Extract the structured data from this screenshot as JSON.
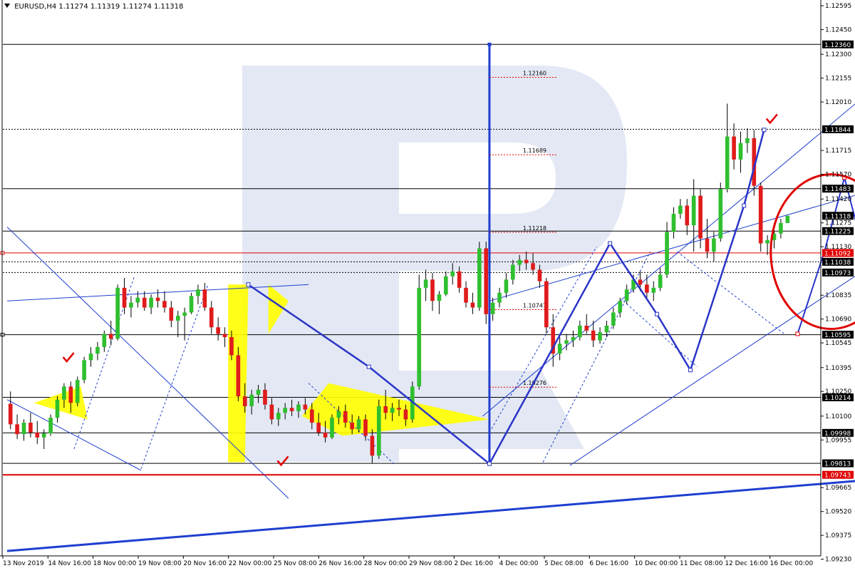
{
  "header": {
    "symbol": "EURUSD,H4",
    "ohlc": "1.11274 1.11319 1.11274 1.11318"
  },
  "colors": {
    "bull": "#2fbf2f",
    "bear": "#e01b1b",
    "trend": "#1f3fd0",
    "wave": "#2a35c8",
    "hline": "#000000",
    "support": "#e00000",
    "circle": "#e00000",
    "highlight": "#ffff00",
    "watermark": "#e3e8f4",
    "fib": "#e00000"
  },
  "chart_data": {
    "type": "candlestick",
    "price_axis": {
      "min": 1.0925,
      "max": 1.1263,
      "ticks": [
        "1.12595",
        "1.12450",
        "1.12300",
        "1.12155",
        "1.12010",
        "1.11715",
        "1.11570",
        "1.11420",
        "1.11275",
        "1.11130",
        "1.10835",
        "1.10690",
        "1.10545",
        "1.10395",
        "1.10250",
        "1.10100",
        "1.09955",
        "1.09665",
        "1.09520",
        "1.09375",
        "1.09230"
      ]
    },
    "time_axis": {
      "labels": [
        "13 Nov 2019",
        "14 Nov 16:00",
        "18 Nov 00:00",
        "19 Nov 08:00",
        "20 Nov 16:00",
        "22 Nov 00:00",
        "25 Nov 08:00",
        "26 Nov 16:00",
        "28 Nov 00:00",
        "29 Nov 08:00",
        "2 Dec 16:00",
        "4 Dec 00:00",
        "5 Dec 08:00",
        "6 Dec 16:00",
        "10 Dec 00:00",
        "11 Dec 08:00",
        "12 Dec 16:00",
        "16 Dec 00:00"
      ]
    },
    "levels": [
      {
        "value": 1.1236,
        "label": "1.12360",
        "style": "solid"
      },
      {
        "value": 1.11844,
        "label": "1.11844",
        "style": "dotted"
      },
      {
        "value": 1.11483,
        "label": "1.11483",
        "style": "solid"
      },
      {
        "value": 1.11318,
        "label": "1.11318",
        "style": "current"
      },
      {
        "value": 1.11225,
        "label": "1.11225",
        "style": "solid"
      },
      {
        "value": 1.11092,
        "label": "1.11092",
        "style": "red"
      },
      {
        "value": 1.11038,
        "label": "1.11038",
        "style": "dotted"
      },
      {
        "value": 1.10973,
        "label": "1.10973",
        "style": "dotted"
      },
      {
        "value": 1.10595,
        "label": "1.10595",
        "style": "solid"
      },
      {
        "value": 1.10214,
        "label": "1.10214",
        "style": "solid"
      },
      {
        "value": 1.09998,
        "label": "1.09998",
        "style": "solid"
      },
      {
        "value": 1.09813,
        "label": "1.09813",
        "style": "solid"
      },
      {
        "value": 1.09743,
        "label": "1.09743",
        "style": "support"
      }
    ],
    "fib_labels": [
      {
        "value": 1.1216,
        "label": "1.12160"
      },
      {
        "value": 1.11689,
        "label": "1.11689"
      },
      {
        "value": 1.11218,
        "label": "1.11218"
      },
      {
        "value": 1.10747,
        "label": "1.10747"
      },
      {
        "value": 1.10276,
        "label": "1.10276"
      }
    ],
    "candles": [
      [
        1.10175,
        1.1025,
        1.1002,
        1.1005
      ],
      [
        1.1005,
        1.1011,
        1.0996,
        1.0999
      ],
      [
        1.0999,
        1.1008,
        1.0995,
        1.1006
      ],
      [
        1.1006,
        1.1012,
        1.0997,
        1.1
      ],
      [
        1.1,
        1.1007,
        1.0993,
        1.0997
      ],
      [
        1.0997,
        1.1002,
        1.099,
        1.09995
      ],
      [
        1.09995,
        1.1011,
        1.0998,
        1.1009
      ],
      [
        1.1009,
        1.1022,
        1.1006,
        1.102
      ],
      [
        1.102,
        1.103,
        1.1015,
        1.1028
      ],
      [
        1.1028,
        1.1031,
        1.1012,
        1.1018
      ],
      [
        1.1018,
        1.1034,
        1.1016,
        1.1032
      ],
      [
        1.1032,
        1.1046,
        1.103,
        1.1044
      ],
      [
        1.1044,
        1.1052,
        1.104,
        1.1048
      ],
      [
        1.1048,
        1.1055,
        1.1044,
        1.1052
      ],
      [
        1.1052,
        1.1062,
        1.1049,
        1.106
      ],
      [
        1.106,
        1.1068,
        1.1053,
        1.1057
      ],
      [
        1.1057,
        1.109,
        1.1056,
        1.1088
      ],
      [
        1.1088,
        1.1094,
        1.1072,
        1.1076
      ],
      [
        1.1076,
        1.1083,
        1.107,
        1.1079
      ],
      [
        1.1079,
        1.1086,
        1.1076,
        1.1082
      ],
      [
        1.1082,
        1.1086,
        1.1074,
        1.1076
      ],
      [
        1.1076,
        1.1084,
        1.1072,
        1.1082
      ],
      [
        1.1082,
        1.1087,
        1.1076,
        1.108
      ],
      [
        1.108,
        1.1086,
        1.1073,
        1.1076
      ],
      [
        1.1076,
        1.108,
        1.1064,
        1.1068
      ],
      [
        1.1068,
        1.1074,
        1.1058,
        1.1071
      ],
      [
        1.1071,
        1.1076,
        1.1056,
        1.1073
      ],
      [
        1.1073,
        1.1085,
        1.1072,
        1.1083
      ],
      [
        1.1083,
        1.109,
        1.1078,
        1.1087
      ],
      [
        1.1087,
        1.1091,
        1.1074,
        1.1076
      ],
      [
        1.1076,
        1.108,
        1.106,
        1.1064
      ],
      [
        1.1064,
        1.107,
        1.1056,
        1.106
      ],
      [
        1.106,
        1.1064,
        1.1052,
        1.1058
      ],
      [
        1.1058,
        1.1062,
        1.1044,
        1.1047
      ],
      [
        1.1047,
        1.1052,
        1.1019,
        1.1022
      ],
      [
        1.1022,
        1.103,
        1.1012,
        1.1016
      ],
      [
        1.1016,
        1.1026,
        1.1011,
        1.1023
      ],
      [
        1.1023,
        1.1029,
        1.1018,
        1.1026
      ],
      [
        1.1026,
        1.103,
        1.1014,
        1.1017
      ],
      [
        1.1017,
        1.1021,
        1.1005,
        1.1008
      ],
      [
        1.1008,
        1.1015,
        1.1004,
        1.1012
      ],
      [
        1.1012,
        1.1018,
        1.1008,
        1.1015
      ],
      [
        1.1015,
        1.102,
        1.101,
        1.1013
      ],
      [
        1.1013,
        1.1019,
        1.1009,
        1.1017
      ],
      [
        1.1017,
        1.1021,
        1.1011,
        1.1014
      ],
      [
        1.1014,
        1.1018,
        1.1002,
        1.1006
      ],
      [
        1.1006,
        1.1012,
        1.0998,
        1.1
      ],
      [
        1.1,
        1.1007,
        1.0994,
        1.0997
      ],
      [
        1.0997,
        1.1011,
        1.0996,
        1.1009
      ],
      [
        1.1009,
        1.1016,
        1.1005,
        1.1013
      ],
      [
        1.1013,
        1.1017,
        1.1003,
        1.1006
      ],
      [
        1.1006,
        1.1011,
        1.0999,
        1.1002
      ],
      [
        1.1002,
        1.101,
        1.1,
        1.1008
      ],
      [
        1.1008,
        1.1011,
        1.0995,
        1.0998
      ],
      [
        1.0998,
        1.1002,
        1.09813,
        1.0986
      ],
      [
        1.0986,
        1.102,
        1.0984,
        1.1016
      ],
      [
        1.1016,
        1.1026,
        1.1008,
        1.1012
      ],
      [
        1.1012,
        1.1018,
        1.1007,
        1.1015
      ],
      [
        1.1015,
        1.102,
        1.101,
        1.1014
      ],
      [
        1.1014,
        1.1017,
        1.1004,
        1.1008
      ],
      [
        1.1008,
        1.1031,
        1.1006,
        1.1028
      ],
      [
        1.1028,
        1.1096,
        1.1026,
        1.1088
      ],
      [
        1.1088,
        1.1099,
        1.108,
        1.1093
      ],
      [
        1.1093,
        1.1097,
        1.1074,
        1.108
      ],
      [
        1.108,
        1.1086,
        1.1072,
        1.1084
      ],
      [
        1.1084,
        1.1098,
        1.1083,
        1.1095
      ],
      [
        1.1095,
        1.1103,
        1.109,
        1.1098
      ],
      [
        1.1098,
        1.1101,
        1.1085,
        1.1088
      ],
      [
        1.1088,
        1.1092,
        1.1076,
        1.1079
      ],
      [
        1.1079,
        1.1085,
        1.1072,
        1.1076
      ],
      [
        1.1076,
        1.1116,
        1.1074,
        1.1112
      ],
      [
        1.1112,
        1.1116,
        1.1066,
        1.1072
      ],
      [
        1.1072,
        1.1082,
        1.1068,
        1.1079
      ],
      [
        1.1079,
        1.1088,
        1.1076,
        1.1085
      ],
      [
        1.1085,
        1.1097,
        1.1082,
        1.1093
      ],
      [
        1.1093,
        1.1105,
        1.109,
        1.1102
      ],
      [
        1.1102,
        1.1108,
        1.1098,
        1.1105
      ],
      [
        1.1105,
        1.111,
        1.1099,
        1.1103
      ],
      [
        1.1103,
        1.1109,
        1.1096,
        1.1099
      ],
      [
        1.1099,
        1.1102,
        1.1088,
        1.1092
      ],
      [
        1.1092,
        1.1094,
        1.106,
        1.1064
      ],
      [
        1.1064,
        1.1072,
        1.104,
        1.1048
      ],
      [
        1.1048,
        1.1058,
        1.1044,
        1.1054
      ],
      [
        1.1054,
        1.106,
        1.105,
        1.1056
      ],
      [
        1.1056,
        1.1062,
        1.1052,
        1.1058
      ],
      [
        1.1058,
        1.1068,
        1.1056,
        1.1065
      ],
      [
        1.1065,
        1.1072,
        1.106,
        1.1062
      ],
      [
        1.1062,
        1.1068,
        1.1052,
        1.1056
      ],
      [
        1.1056,
        1.1064,
        1.1054,
        1.1061
      ],
      [
        1.1061,
        1.1068,
        1.1058,
        1.1065
      ],
      [
        1.1065,
        1.1076,
        1.1063,
        1.1073
      ],
      [
        1.1073,
        1.1082,
        1.107,
        1.108
      ],
      [
        1.108,
        1.109,
        1.1078,
        1.1087
      ],
      [
        1.1087,
        1.1096,
        1.1085,
        1.1093
      ],
      [
        1.1093,
        1.1098,
        1.1086,
        1.109
      ],
      [
        1.109,
        1.1096,
        1.1082,
        1.1085
      ],
      [
        1.1085,
        1.1092,
        1.108,
        1.1088
      ],
      [
        1.1088,
        1.11,
        1.1086,
        1.1096
      ],
      [
        1.1096,
        1.1128,
        1.1094,
        1.1122
      ],
      [
        1.1122,
        1.1137,
        1.1118,
        1.1133
      ],
      [
        1.1133,
        1.1142,
        1.113,
        1.1138
      ],
      [
        1.1138,
        1.1142,
        1.112,
        1.1126
      ],
      [
        1.1126,
        1.1154,
        1.111,
        1.1144
      ],
      [
        1.1144,
        1.1148,
        1.1112,
        1.1118
      ],
      [
        1.1118,
        1.113,
        1.1106,
        1.111
      ],
      [
        1.111,
        1.1122,
        1.1104,
        1.1118
      ],
      [
        1.1118,
        1.1152,
        1.1116,
        1.1148
      ],
      [
        1.1148,
        1.12,
        1.1146,
        1.118
      ],
      [
        1.118,
        1.1188,
        1.116,
        1.1166
      ],
      [
        1.1166,
        1.1183,
        1.1158,
        1.1176
      ],
      [
        1.1176,
        1.1185,
        1.117,
        1.1179
      ],
      [
        1.1179,
        1.1184,
        1.1144,
        1.115
      ],
      [
        1.115,
        1.1152,
        1.111,
        1.1115
      ],
      [
        1.1115,
        1.112,
        1.1108,
        1.1117
      ],
      [
        1.1117,
        1.1124,
        1.1112,
        1.1121
      ],
      [
        1.1121,
        1.113,
        1.1118,
        1.11274
      ],
      [
        1.11274,
        1.11319,
        1.11274,
        1.11318
      ]
    ]
  }
}
